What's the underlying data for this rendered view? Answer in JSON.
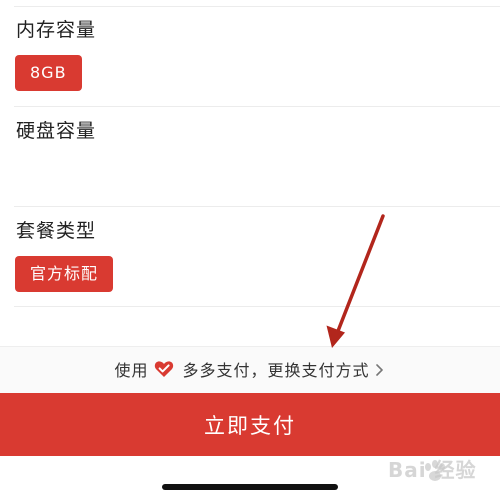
{
  "sections": {
    "memory": {
      "title": "内存容量",
      "selected_option": "8GB"
    },
    "storage": {
      "title": "硬盘容量"
    },
    "package": {
      "title": "套餐类型",
      "selected_option": "官方标配"
    }
  },
  "payment_method": {
    "prefix": "使用",
    "icon": "heart-icon",
    "method_name": "多多支付",
    "change_label": "，更换支付方式",
    "chevron_icon": "chevron-right-icon"
  },
  "pay_button": {
    "label": "立即支付"
  },
  "watermark": {
    "text": "Bai 经验"
  },
  "colors": {
    "accent": "#d93a31",
    "text": "#222222",
    "annotation_arrow": "#b2261c"
  }
}
